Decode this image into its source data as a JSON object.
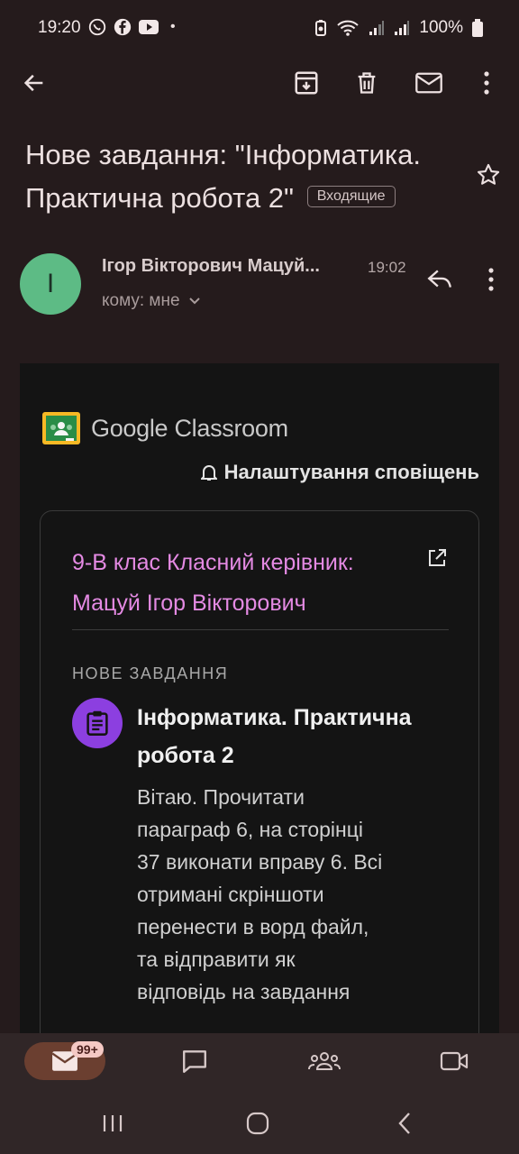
{
  "status_bar": {
    "time": "19:20",
    "dot": "•",
    "battery": "100%",
    "left_icons": [
      "viber-icon",
      "facebook-icon",
      "youtube-icon"
    ],
    "right_icons": [
      "battery-saver-icon",
      "wifi-icon",
      "signal-icon",
      "signal-icon",
      "battery-icon"
    ]
  },
  "app_bar": {
    "icons": [
      "back-arrow-icon",
      "archive-icon",
      "delete-icon",
      "mark-unread-icon",
      "more-vert-icon"
    ]
  },
  "email": {
    "subject": "Нове завдання: \"Інформатика. Практична робота 2\"",
    "label": "Входящие",
    "sender_initial": "І",
    "sender_name": "Ігор Вікторович Мацуй...",
    "time": "19:02",
    "recipient": "кому: мне"
  },
  "body": {
    "logo_text": "Google Classroom",
    "notification_settings": "Налаштування сповіщень",
    "class_name": "9-В клас Класний керівник: Мацуй Ігор Вікторович",
    "section_label": "НОВЕ ЗАВДАННЯ",
    "assignment_title": "Інформатика. Практична робота 2",
    "assignment_desc": "Вітаю. Прочитати параграф 6, на сторінці 37 виконати вправу 6. Всі отримані скріншоти перенести в ворд файл, та відправити як відповідь на завдання"
  },
  "bottom_nav": {
    "badge": "99+",
    "items": [
      "mail-icon",
      "chat-icon",
      "spaces-icon",
      "meet-icon"
    ]
  },
  "colors": {
    "background": "#251b1c",
    "avatar": "#5dbb85",
    "class_link": "#e48ae3",
    "assignment_icon": "#8c3fe0"
  }
}
